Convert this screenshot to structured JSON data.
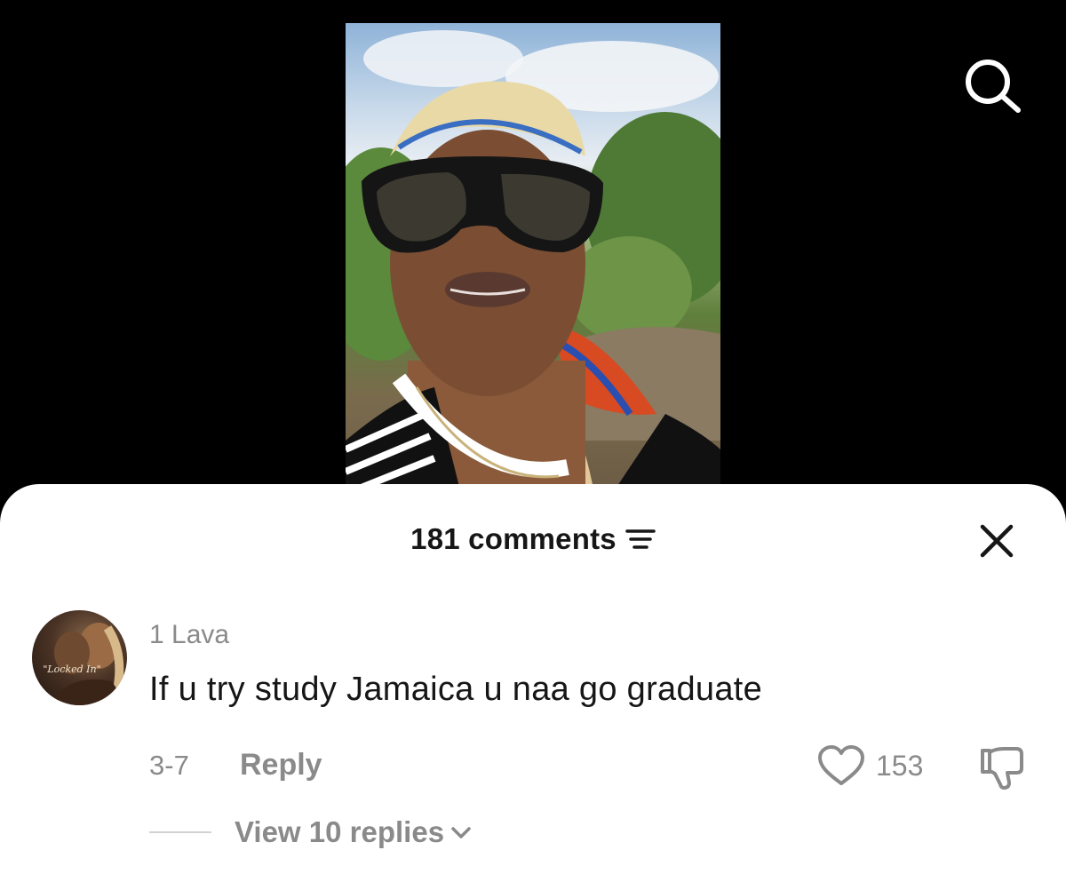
{
  "video": {
    "icon": "video-thumbnail"
  },
  "top_bar": {
    "search_icon": "search-icon"
  },
  "comments_sheet": {
    "count_label": "181 comments",
    "sort_icon": "sort-lines-icon",
    "close_icon": "close-icon"
  },
  "comment": {
    "avatar_caption": "\"Locked In\"",
    "username": "1 Lava",
    "text": "If u try study Jamaica u naa go graduate",
    "date": "3-7",
    "reply_label": "Reply",
    "likes": "153",
    "like_icon": "heart-outline-icon",
    "dislike_icon": "thumbs-down-icon",
    "view_replies_label": "View 10 replies",
    "replies_chevron": "chevron-down-icon"
  },
  "colors": {
    "background": "#000000",
    "sheet": "#ffffff",
    "primary_text": "#161616",
    "secondary_text": "#8a8a8a"
  }
}
